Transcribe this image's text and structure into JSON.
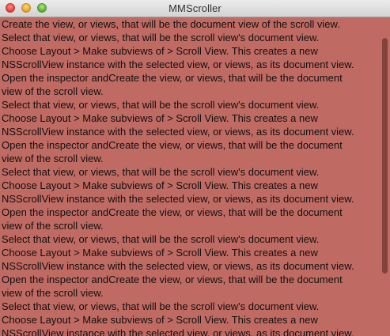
{
  "window": {
    "title": "MMScroller"
  },
  "document": {
    "lines": [
      "Create the view, or views, that will be the document view of the scroll view.",
      "Select that view, or views, that will be the scroll view's document view.",
      "Choose Layout > Make subviews of > Scroll View. This creates a new",
      "NSScrollView instance with the selected view, or views, as its document view.",
      "Open the inspector andCreate the view, or views, that will be the document",
      "view of the scroll view.",
      "Select that view, or views, that will be the scroll view's document view.",
      "Choose Layout > Make subviews of > Scroll View. This creates a new",
      "NSScrollView instance with the selected view, or views, as its document view.",
      "Open the inspector andCreate the view, or views, that will be the document",
      "view of the scroll view.",
      "Select that view, or views, that will be the scroll view's document view.",
      "Choose Layout > Make subviews of > Scroll View. This creates a new",
      "NSScrollView instance with the selected view, or views, as its document view.",
      "Open the inspector andCreate the view, or views, that will be the document",
      "view of the scroll view.",
      "Select that view, or views, that will be the scroll view's document view.",
      "Choose Layout > Make subviews of > Scroll View. This creates a new",
      "NSScrollView instance with the selected view, or views, as its document view.",
      "Open the inspector andCreate the view, or views, that will be the document",
      "view of the scroll view.",
      "Select that view, or views, that will be the scroll view's document view.",
      "Choose Layout > Make subviews of > Scroll View. This creates a new",
      "NSScrollView instance with the selected view, or views, as its document view."
    ]
  },
  "colors": {
    "document_background": "#bf6a62",
    "close_button": "#e0443e",
    "minimize_button": "#e5a533",
    "zoom_button": "#5eae3a"
  }
}
